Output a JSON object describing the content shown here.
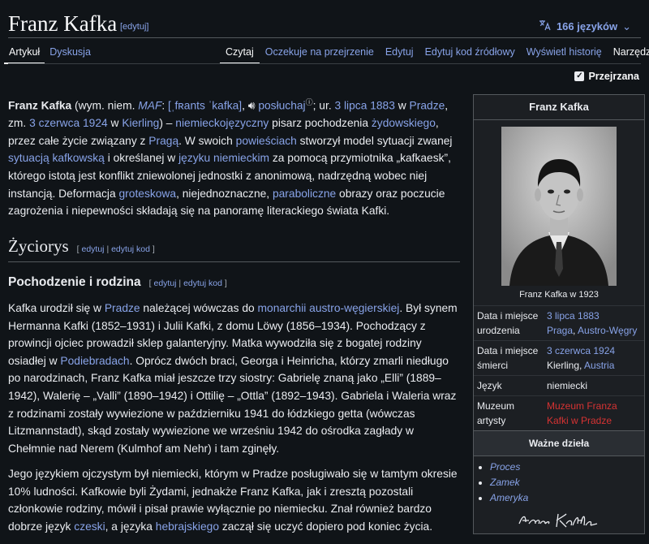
{
  "header": {
    "title": "Franz Kafka",
    "title_edit": "[edytuj]",
    "languages": "166 języków"
  },
  "tabs_left": [
    "Artykuł",
    "Dyskusja"
  ],
  "tabs_right": [
    "Czytaj",
    "Oczekuje na przejrzenie",
    "Edytuj",
    "Edytuj kod źródłowy",
    "Wyświetl historię"
  ],
  "tools_label": "Narzędzia",
  "reviewed_label": "Przejrzana",
  "lead": {
    "name": "Franz Kafka",
    "t1": " (wym. niem. ",
    "maf": "MAF",
    "t2": ": ",
    "ipa": "[ˌfʀants ˈkafka]",
    "t3": ", ",
    "listen": "posłuchaj",
    "t4": "; ur. ",
    "birth_date": "3 lipca 1883",
    "t5": " w ",
    "birth_place": "Pradze",
    "t6": ", zm. ",
    "death_date": "3 czerwca 1924",
    "t7": " w ",
    "death_place": "Kierling",
    "t8": ") – ",
    "language_link": "niemieckojęzyczny",
    "t9": " pisarz pochodzenia ",
    "origin_link": "żydowskiego",
    "t10": ", przez całe życie związany z ",
    "prague_link": "Pragą",
    "t11": ". W swoich ",
    "novels_link": "powieściach",
    "t12": " stworzył model sytuacji zwanej ",
    "situation_link": "sytuacją kafkowską",
    "t13": " i określanej w ",
    "german_link": "języku niemieckim",
    "t14": " za pomocą przymiotnika „kafkaesk”, którego istotą jest konflikt zniewolonej jednostki z anonimową, nadrzędną wobec niej instancją. Deformacja ",
    "grotesque_link": "groteskowa",
    "t15": ", niejednoznaczne, ",
    "parabolic_link": "paraboliczne",
    "t16": " obrazy oraz poczucie zagrożenia i niepewności składają się na panoramę literackiego świata Kafki."
  },
  "section": {
    "title": "Życiorys",
    "edit": "edytuj",
    "edit_code": "edytuj kod",
    "sub_title": "Pochodzenie i rodzina"
  },
  "para1": {
    "t1": "Kafka urodził się w ",
    "prague": "Pradze",
    "t2": " należącej wówczas do ",
    "monarchy": "monarchii austro-węgierskiej",
    "t3": ". Był synem Hermanna Kafki (1852–1931) i Julii Kafki, z domu Löwy (1856–1934). Pochodzący z prowincji ojciec prowadził sklep galanteryjny. Matka wywodziła się z bogatej rodziny osiadłej w ",
    "podiebrady": "Podiebradach",
    "t4": ". Oprócz dwóch braci, Georga i Heinricha, którzy zmarli niedługo po narodzinach, Franz Kafka miał jeszcze trzy siostry: Gabrielę znaną jako „Elli” (1889–1942), Walerię – „Valli” (1890–1942) i Ottilię – „Ottla” (1892–1943). Gabriela i Waleria wraz z rodzinami zostały wywiezione w październiku 1941 do łódzkiego getta (wówczas Litzmannstadt), skąd zostały wywiezione we wrześniu 1942 do ośrodka zagłady w Chełmnie nad Nerem (Kulmhof am Nehr) i tam zginęły."
  },
  "para2": {
    "t1": "Jego językiem ojczystym był niemiecki, którym w Pradze posługiwało się w tamtym okresie 10% ludności. Kafkowie byli Żydami, jednakże Franz Kafka, jak i zresztą pozostali członkowie rodziny, mówił i pisał prawie wyłącznie po niemiecku. Znał również bardzo dobrze język ",
    "czech": "czeski",
    "t2": ", a języka ",
    "hebrew": "hebrajskiego",
    "t3": " zaczął się uczyć dopiero pod koniec życia."
  },
  "infobox": {
    "title": "Franz Kafka",
    "caption": "Franz Kafka w 1923",
    "birth_label": "Data i miejsce urodzenia",
    "birth_date": "3 lipca 1883",
    "birth_city": "Praga",
    "birth_country": "Austro-Węgry",
    "death_label": "Data i miejsce śmierci",
    "death_date": "3 czerwca 1924",
    "death_city": "Kierling",
    "death_country": "Austria",
    "lang_label": "Język",
    "lang_value": "niemiecki",
    "museum_label": "Muzeum artysty",
    "museum_value": "Muzeum Franza Kafki w Pradze",
    "works_title": "Ważne dzieła",
    "works": [
      "Proces",
      "Zamek",
      "Ameryka"
    ],
    "signature": "Franz Kafka"
  }
}
